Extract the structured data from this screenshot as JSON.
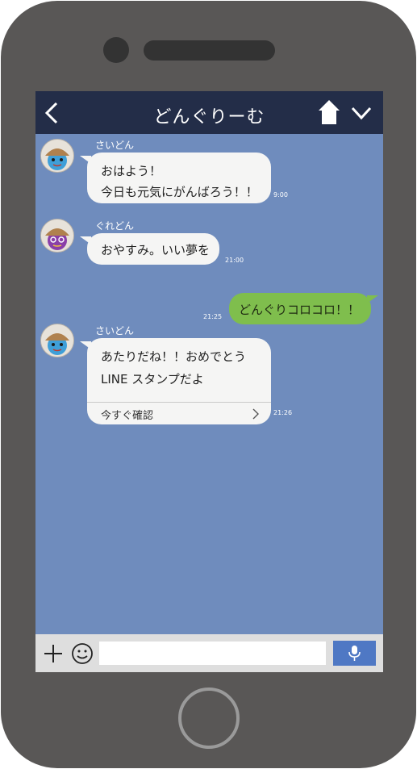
{
  "header": {
    "title": "どんぐりーむ",
    "back_icon": "chevron-left-icon",
    "home_icon": "house-icon",
    "menu_icon": "chevron-down-icon"
  },
  "messages": [
    {
      "sender": "さいどん",
      "lines": [
        "おはよう！",
        "今日も元気にがんばろう！！"
      ],
      "time": "9:00",
      "avatar": "acorn-avatar-blue"
    },
    {
      "sender": "ぐれどん",
      "lines": [
        "おやすみ。いい夢を"
      ],
      "time": "21:00",
      "avatar": "acorn-avatar-purple"
    },
    {
      "sender": "",
      "lines": [
        "どんぐりコロコロ！！"
      ],
      "time": "21:25",
      "mine": true
    },
    {
      "sender": "さいどん",
      "lines": [
        "あたりだね！！おめでとう",
        "LINE スタンプだよ"
      ],
      "time": "21:26",
      "link": "今すぐ確認",
      "avatar": "acorn-avatar-blue"
    }
  ],
  "input_bar": {
    "plus_icon": "plus-icon",
    "emoji_icon": "smile-icon",
    "placeholder": "",
    "mic_icon": "microphone-icon"
  },
  "colors": {
    "screen_bg": "#6f8cbd",
    "header_bg": "#232d48",
    "my_bubble": "#7fbe4d",
    "their_bubble": "#f5f5f4",
    "mic_button": "#4f78c4",
    "phone_body": "#595756"
  }
}
